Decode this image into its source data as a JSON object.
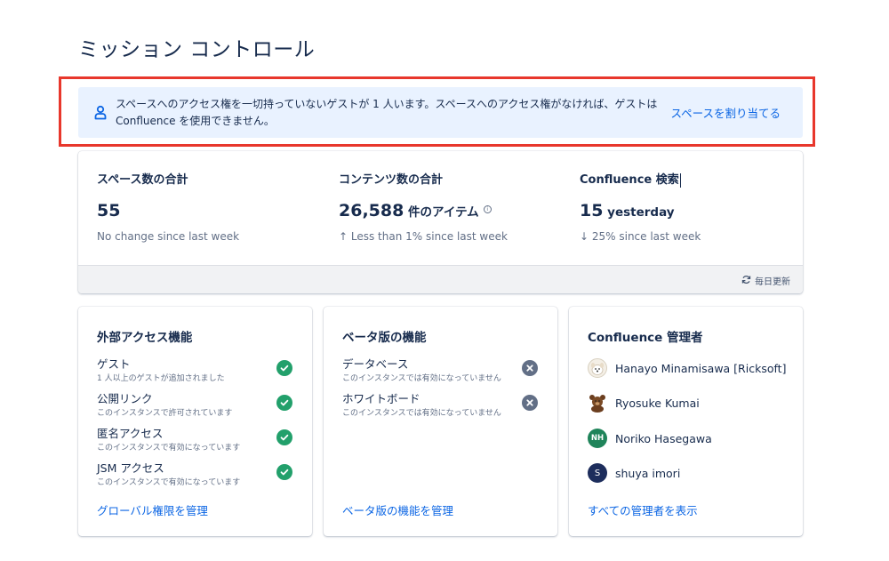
{
  "page": {
    "title": "ミッション コントロール"
  },
  "banner": {
    "text": "スペースへのアクセス権を一切持っていないゲストが 1 人います。スペースへのアクセス権がなければ、ゲストは Confluence を使用できません。",
    "link": "スペースを割り当てる",
    "icon": "person-icon"
  },
  "stats": [
    {
      "title": "スペース数の合計",
      "value": "55",
      "suffix": "",
      "sub": "No change since last week"
    },
    {
      "title": "コンテンツ数の合計",
      "value": "26,588",
      "suffix": " 件のアイテム",
      "sub": "↑ Less than 1% since last week"
    },
    {
      "title": "Confluence 検索",
      "value": "15",
      "suffix": " yesterday",
      "sub": "↓ 25% since last week"
    }
  ],
  "refresh_label": "毎日更新",
  "external_access": {
    "title": "外部アクセス機能",
    "items": [
      {
        "name": "ゲスト",
        "desc": "1 人以上のゲストが追加されました",
        "status": "enabled"
      },
      {
        "name": "公開リンク",
        "desc": "このインスタンスで許可されています",
        "status": "enabled"
      },
      {
        "name": "匿名アクセス",
        "desc": "このインスタンスで有効になっています",
        "status": "enabled"
      },
      {
        "name": "JSM アクセス",
        "desc": "このインスタンスで有効になっています",
        "status": "enabled"
      }
    ],
    "link": "グローバル権限を管理"
  },
  "beta": {
    "title": "ベータ版の機能",
    "items": [
      {
        "name": "データベース",
        "desc": "このインスタンスでは有効になっていません",
        "status": "disabled"
      },
      {
        "name": "ホワイトボード",
        "desc": "このインスタンスでは有効になっていません",
        "status": "disabled"
      }
    ],
    "link": "ベータ版の機能を管理"
  },
  "admins": {
    "title": "Confluence 管理者",
    "items": [
      {
        "name": "Hanayo Minamisawa [Ricksoft]",
        "initials": "",
        "avatar": "dog-photo"
      },
      {
        "name": "Ryosuke Kumai",
        "initials": "",
        "avatar": "bear-photo"
      },
      {
        "name": "Noriko Hasegawa",
        "initials": "NH",
        "color": "#1f845a"
      },
      {
        "name": "shuya imori",
        "initials": "S",
        "color": "#1d2d5c"
      }
    ],
    "link": "すべての管理者を表示"
  }
}
